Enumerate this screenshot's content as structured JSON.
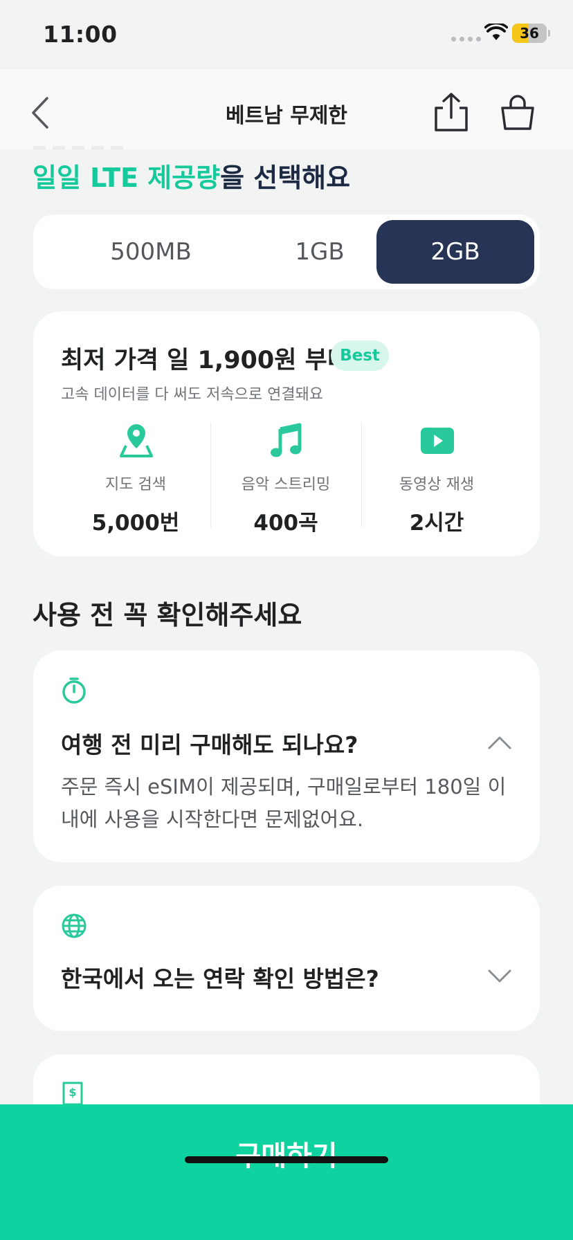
{
  "status_bar": {
    "time": "11:00",
    "battery": "36"
  },
  "nav": {
    "title": "베트남 무제한",
    "back_icon": "chevron-left-icon",
    "share_icon": "share-icon",
    "cart_icon": "shopping-bag-icon"
  },
  "headline": {
    "accent": "일일 LTE 제공량",
    "rest": "을 선택해요"
  },
  "data_options": {
    "items": [
      "500MB",
      "1GB",
      "2GB"
    ],
    "selected": "2GB"
  },
  "plan": {
    "title": "최저 가격 일 1,900원 부터",
    "badge": "Best",
    "subtitle": "고속 데이터를 다 써도 저속으로 연결돼요",
    "features": [
      {
        "icon": "map-pin-icon",
        "label": "지도 검색",
        "value": "5,000번"
      },
      {
        "icon": "music-note-icon",
        "label": "음악 스트리밍",
        "value": "400곡"
      },
      {
        "icon": "play-video-icon",
        "label": "동영상 재생",
        "value": "2시간"
      }
    ]
  },
  "faq_section": {
    "title": "사용 전 꼭 확인해주세요",
    "items": [
      {
        "icon": "timer-icon",
        "question": "여행 전 미리 구매해도 되나요?",
        "answer": "주문 즉시 eSIM이 제공되며, 구매일로부터 180일 이내에 사용을 시작한다면 문제없어요.",
        "expanded": true
      },
      {
        "icon": "globe-icon",
        "question": "한국에서 오는 연락 확인 방법은?",
        "expanded": false
      },
      {
        "icon": "receipt-icon",
        "question": "",
        "expanded": false
      }
    ]
  },
  "buy_button": {
    "label": "구매하기"
  },
  "colors": {
    "accent": "#15c99a",
    "navy": "#273455",
    "buy": "#0ed3a0",
    "background": "#f2f4f4"
  }
}
